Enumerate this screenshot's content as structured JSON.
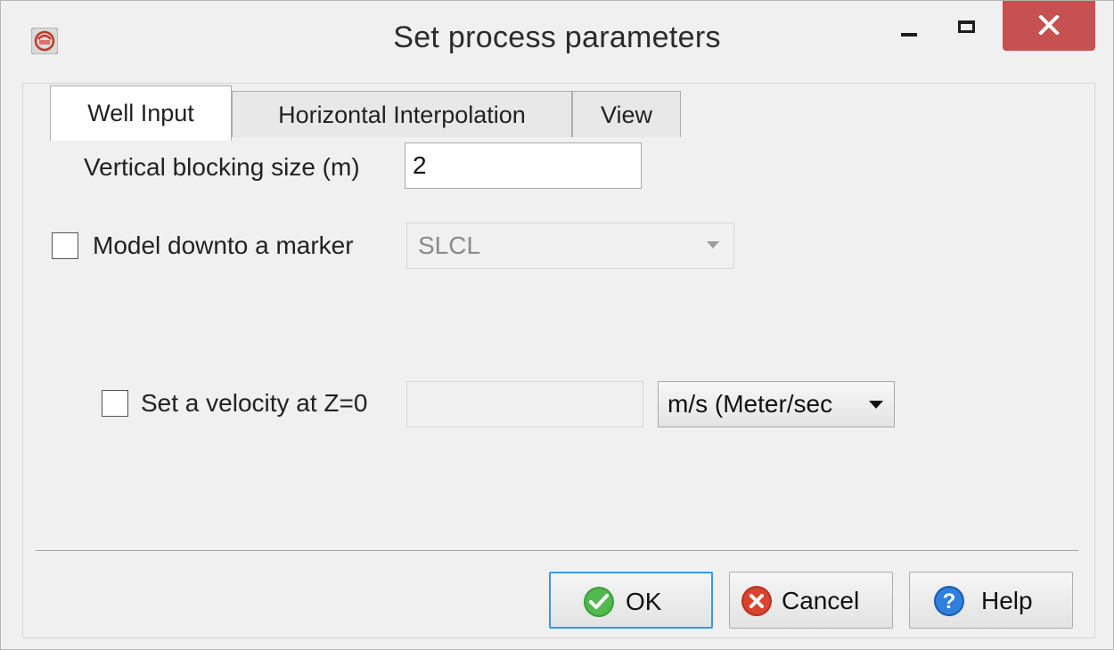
{
  "window": {
    "title": "Set process parameters",
    "icon": "app-logo-icon",
    "controls": [
      "minimize-icon",
      "maximize-icon",
      "close-icon"
    ]
  },
  "tabs": [
    {
      "label": "Well Input",
      "active": true
    },
    {
      "label": "Horizontal Interpolation",
      "active": false
    },
    {
      "label": "View",
      "active": false
    }
  ],
  "form": {
    "vertical_blocking_label": "Vertical blocking size (m)",
    "vertical_blocking_value": "2",
    "model_downto_label": "Model downto a marker",
    "model_downto_checked": false,
    "marker_value": "SLCL",
    "velocity_label": "Set a velocity at Z=0",
    "velocity_checked": false,
    "velocity_value": "",
    "velocity_unit": "m/s (Meter/sec"
  },
  "buttons": {
    "ok": "OK",
    "cancel": "Cancel",
    "help": "Help"
  },
  "colors": {
    "close_button": "#c75050",
    "ok_icon": "#3a9d3a",
    "cancel_icon": "#d9432f",
    "help_icon": "#1f6fd1",
    "default_button_border": "#3c96e8"
  }
}
